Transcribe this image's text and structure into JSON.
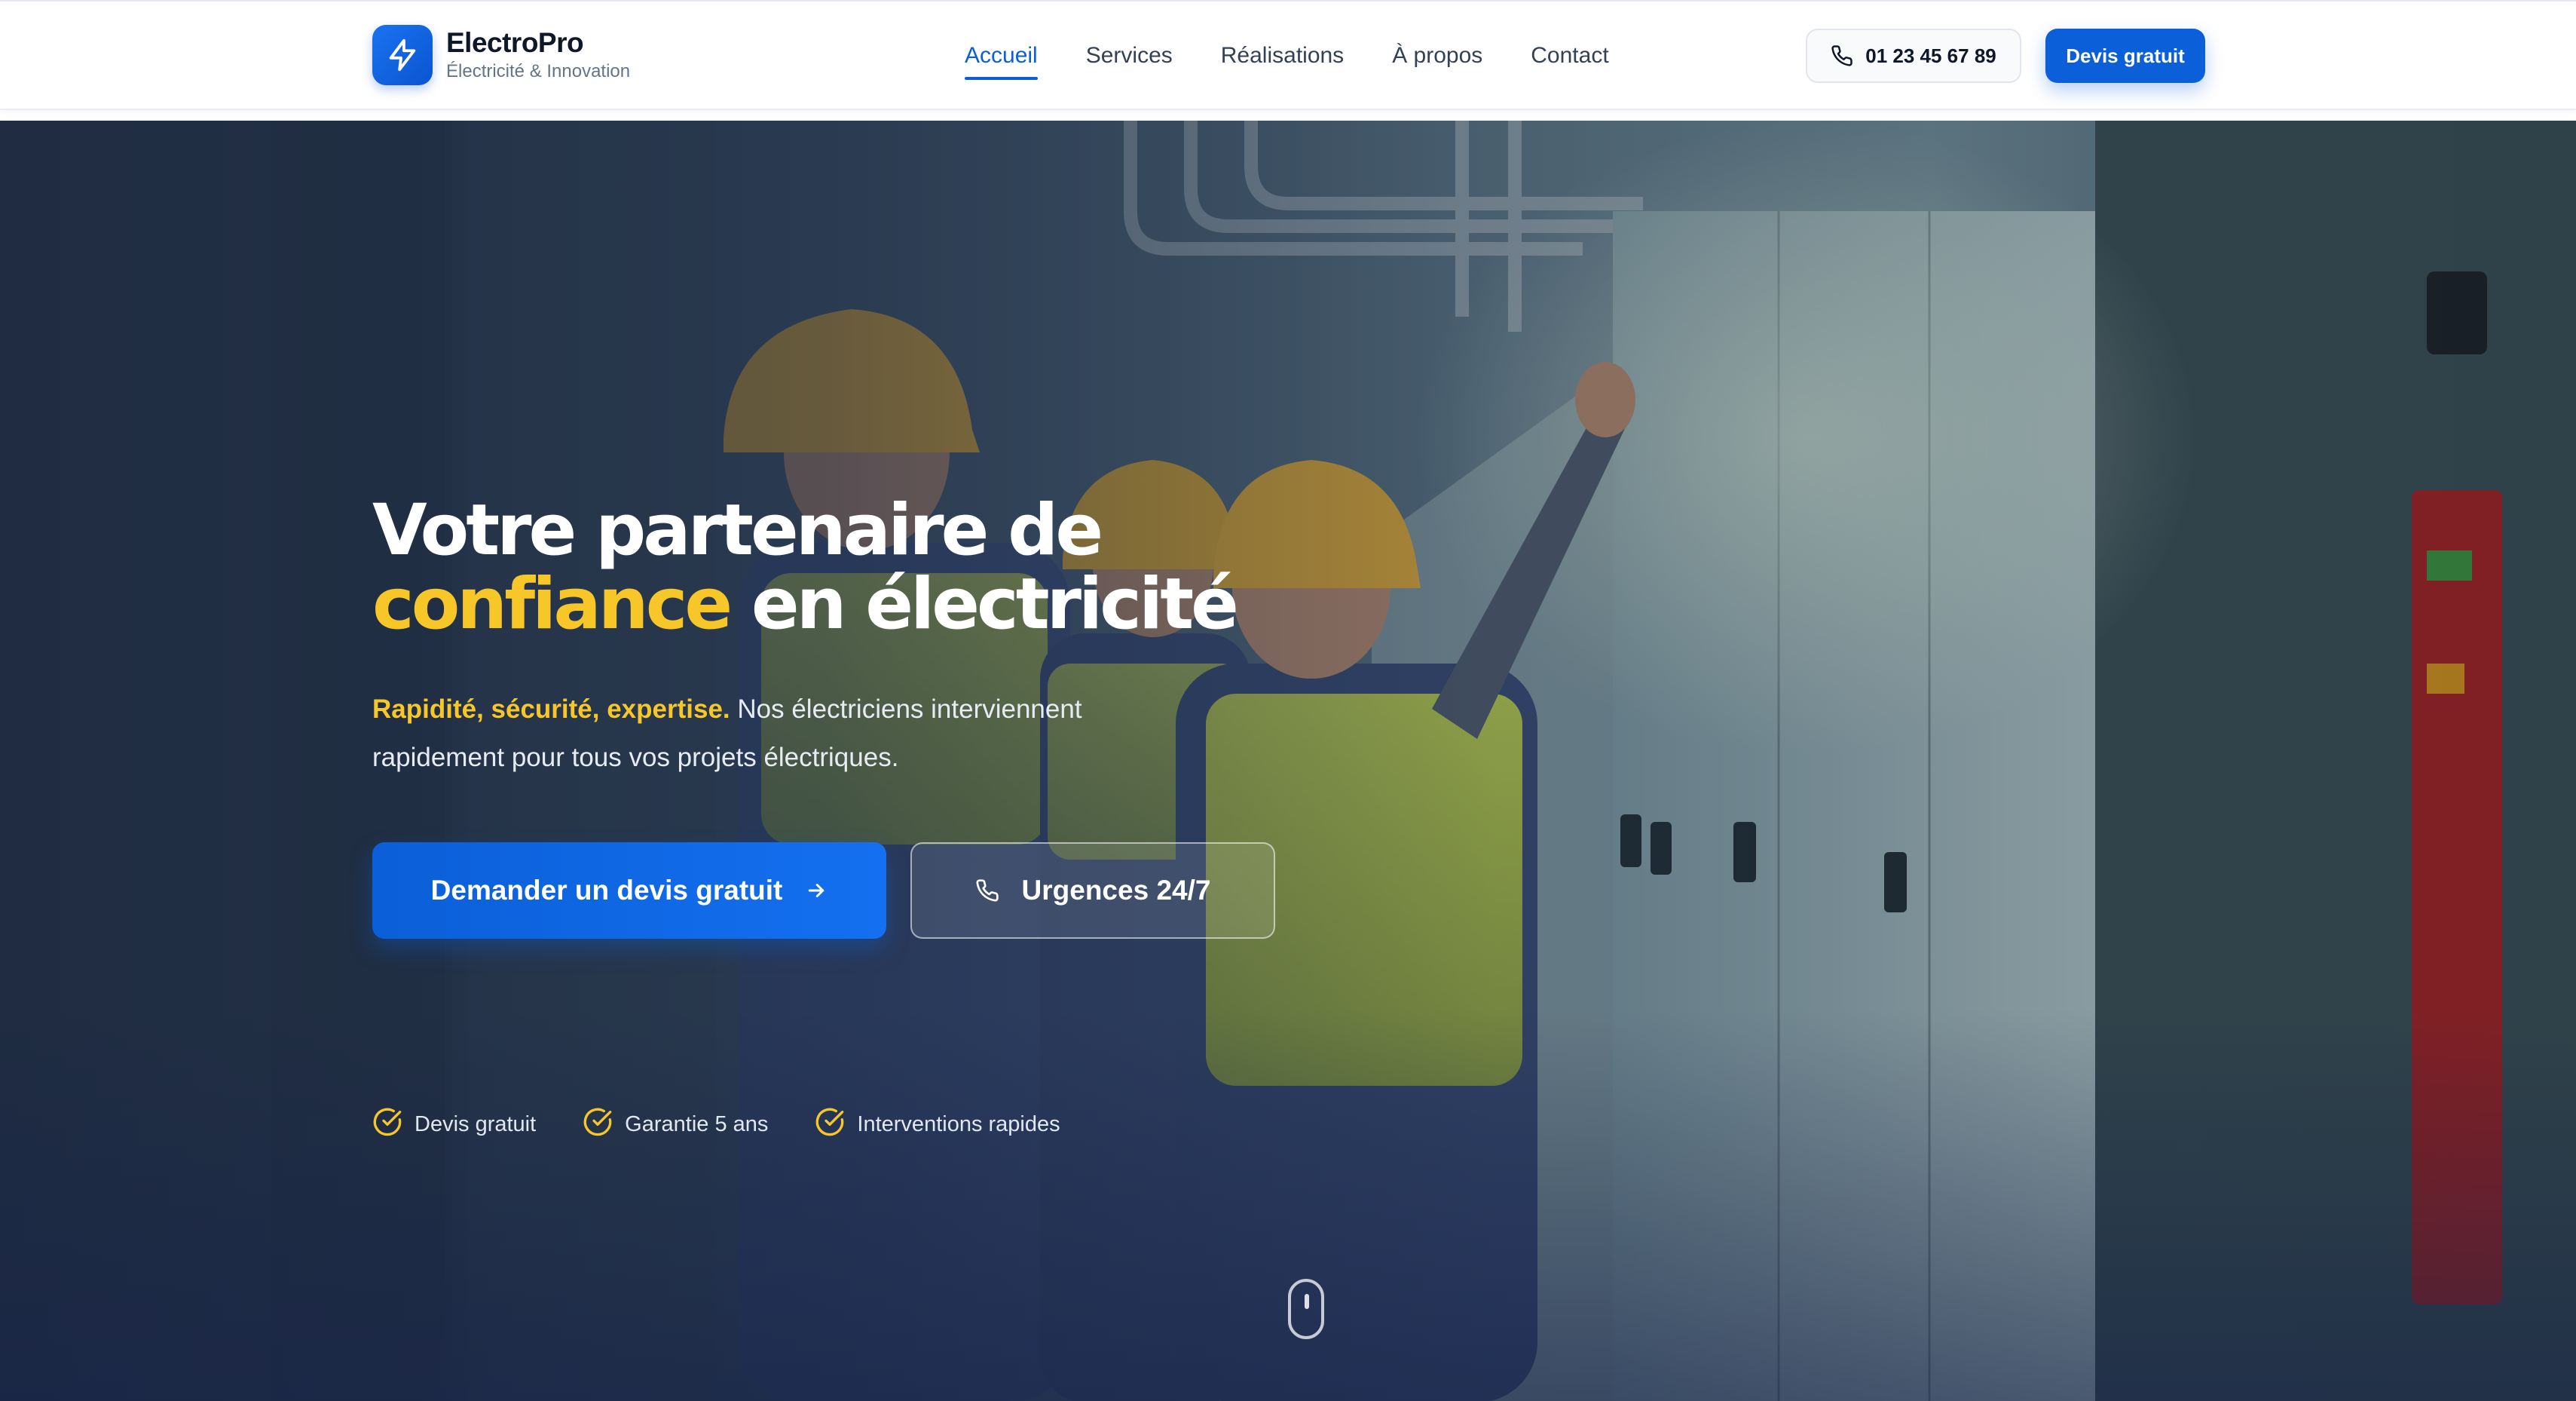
{
  "brand": {
    "name": "ElectroPro",
    "tagline": "Électricité & Innovation",
    "logo_icon": "lightning-bolt-icon"
  },
  "nav": {
    "items": [
      {
        "label": "Accueil",
        "active": true
      },
      {
        "label": "Services",
        "active": false
      },
      {
        "label": "Réalisations",
        "active": false
      },
      {
        "label": "À propos",
        "active": false
      },
      {
        "label": "Contact",
        "active": false
      }
    ]
  },
  "header_actions": {
    "phone": "01 23 45 67 89",
    "phone_icon": "phone-icon",
    "devis_label": "Devis gratuit"
  },
  "hero": {
    "title_line1": "Votre partenaire de",
    "title_accent": "confiance",
    "title_line2_rest": "en électricité",
    "subtitle_accent": "Rapidité, sécurité, expertise.",
    "subtitle_rest": "Nos électriciens interviennent rapidement pour tous vos projets électriques.",
    "cta_primary": "Demander un devis gratuit",
    "cta_secondary": "Urgences 24/7",
    "badges": [
      {
        "label": "Devis gratuit",
        "icon": "check-circle-icon"
      },
      {
        "label": "Garantie 5 ans",
        "icon": "check-circle-icon"
      },
      {
        "label": "Interventions rapides",
        "icon": "check-circle-icon"
      }
    ],
    "background_image": "electricians-working-on-electrical-panel"
  },
  "colors": {
    "primary": "#0b5fd8",
    "accent": "#f7c72a",
    "text_dark": "#0f172a",
    "text_muted": "#64748b"
  }
}
